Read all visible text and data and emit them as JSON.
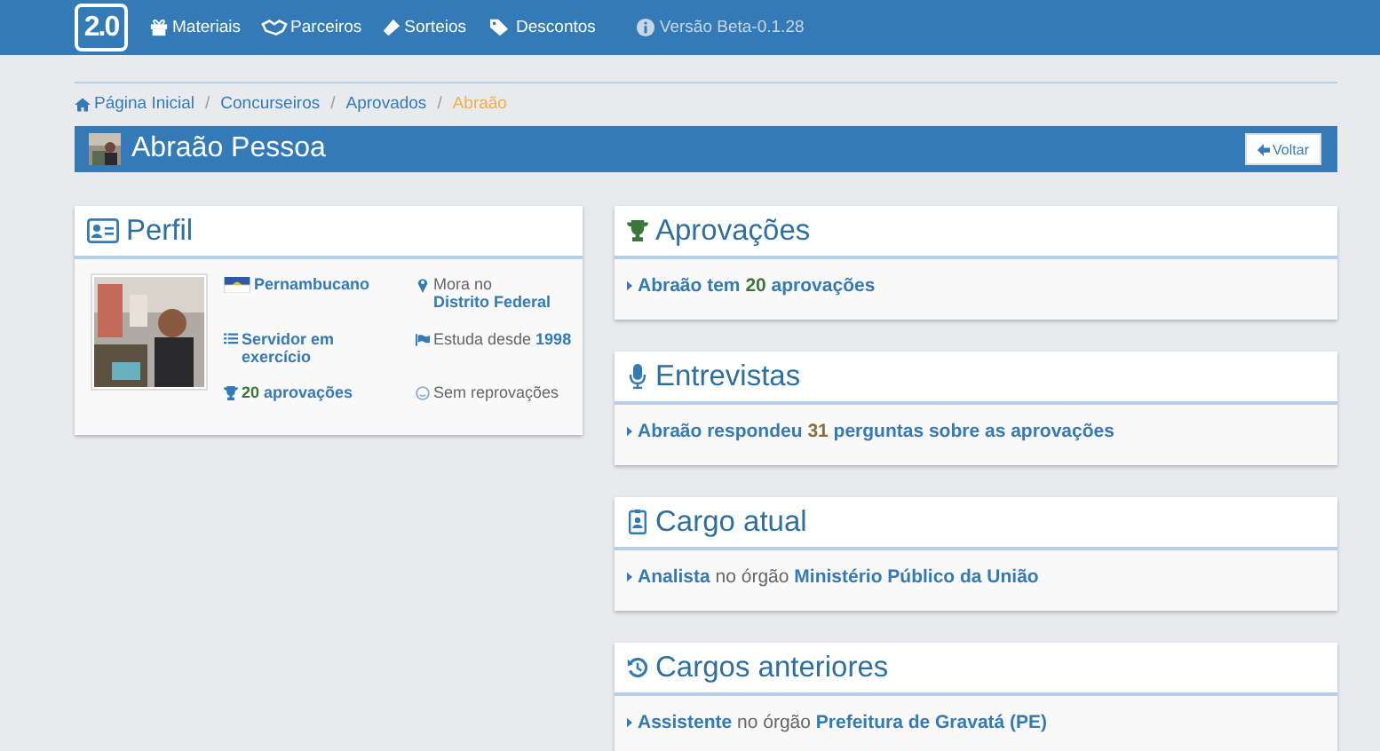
{
  "navbar": {
    "logo": "2.0",
    "items": [
      {
        "kind": "gift",
        "label": "Materiais"
      },
      {
        "kind": "handshake",
        "label": "Parceiros"
      },
      {
        "kind": "ticket",
        "label": "Sorteios"
      },
      {
        "kind": "tags",
        "label": "Descontos"
      },
      {
        "kind": "info",
        "label": "Versão Beta-0.1.28"
      }
    ]
  },
  "breadcrumb": {
    "separator": "/",
    "items": [
      {
        "label": "Página Inicial",
        "selected": false
      },
      {
        "label": "Concurseiros",
        "selected": false
      },
      {
        "label": "Aprovados",
        "selected": false
      },
      {
        "label": "Abraão",
        "selected": true
      }
    ]
  },
  "title": {
    "name": "Abraão Pessoa",
    "back_button": "Voltar"
  },
  "profile": {
    "title": "Perfil",
    "items": [
      {
        "kind": "state",
        "segments": [
          {
            "kind": "link",
            "text": "Pernambucano"
          }
        ]
      },
      {
        "kind": "residence",
        "segments": [
          {
            "kind": "plain",
            "text": "Mora no "
          },
          {
            "kind": "link",
            "text": "Distrito Federal"
          }
        ]
      },
      {
        "kind": "job",
        "segments": [
          {
            "kind": "link",
            "text": "Servidor em exercício"
          }
        ]
      },
      {
        "kind": "study",
        "segments": [
          {
            "kind": "plain",
            "text": "Estuda desde "
          },
          {
            "kind": "link",
            "text": "1998"
          }
        ]
      },
      {
        "kind": "approvals",
        "segments": [
          {
            "kind": "count",
            "text": "20",
            "color": "#3c763d"
          },
          {
            "kind": "link",
            "text": " aprovações"
          }
        ]
      },
      {
        "kind": "failures",
        "segments": [
          {
            "kind": "plain",
            "text": "Sem reprovações"
          }
        ]
      }
    ]
  },
  "panels": [
    {
      "kind": "trophy",
      "title": "Aprovações",
      "lines": [
        [
          {
            "kind": "link",
            "text": "Abraão tem "
          },
          {
            "kind": "count",
            "text": "20",
            "color": "#3c763d"
          },
          {
            "kind": "link",
            "text": " aprovações"
          }
        ]
      ]
    },
    {
      "kind": "microphone",
      "title": "Entrevistas",
      "lines": [
        [
          {
            "kind": "link",
            "text": "Abraão respondeu "
          },
          {
            "kind": "count",
            "text": "31",
            "color": "#8a6d3b"
          },
          {
            "kind": "link",
            "text": " perguntas sobre as aprovações"
          }
        ]
      ]
    },
    {
      "kind": "badge",
      "title": "Cargo atual",
      "lines": [
        [
          {
            "kind": "link",
            "text": "Analista"
          },
          {
            "kind": "plain",
            "text": " no órgão "
          },
          {
            "kind": "link",
            "text": "Ministério Público da União"
          }
        ]
      ]
    },
    {
      "kind": "history",
      "title": "Cargos anteriores",
      "lines": [
        [
          {
            "kind": "link",
            "text": "Assistente"
          },
          {
            "kind": "plain",
            "text": " no órgão "
          },
          {
            "kind": "link",
            "text": "Prefeitura de Gravatá (PE)"
          }
        ]
      ]
    }
  ]
}
